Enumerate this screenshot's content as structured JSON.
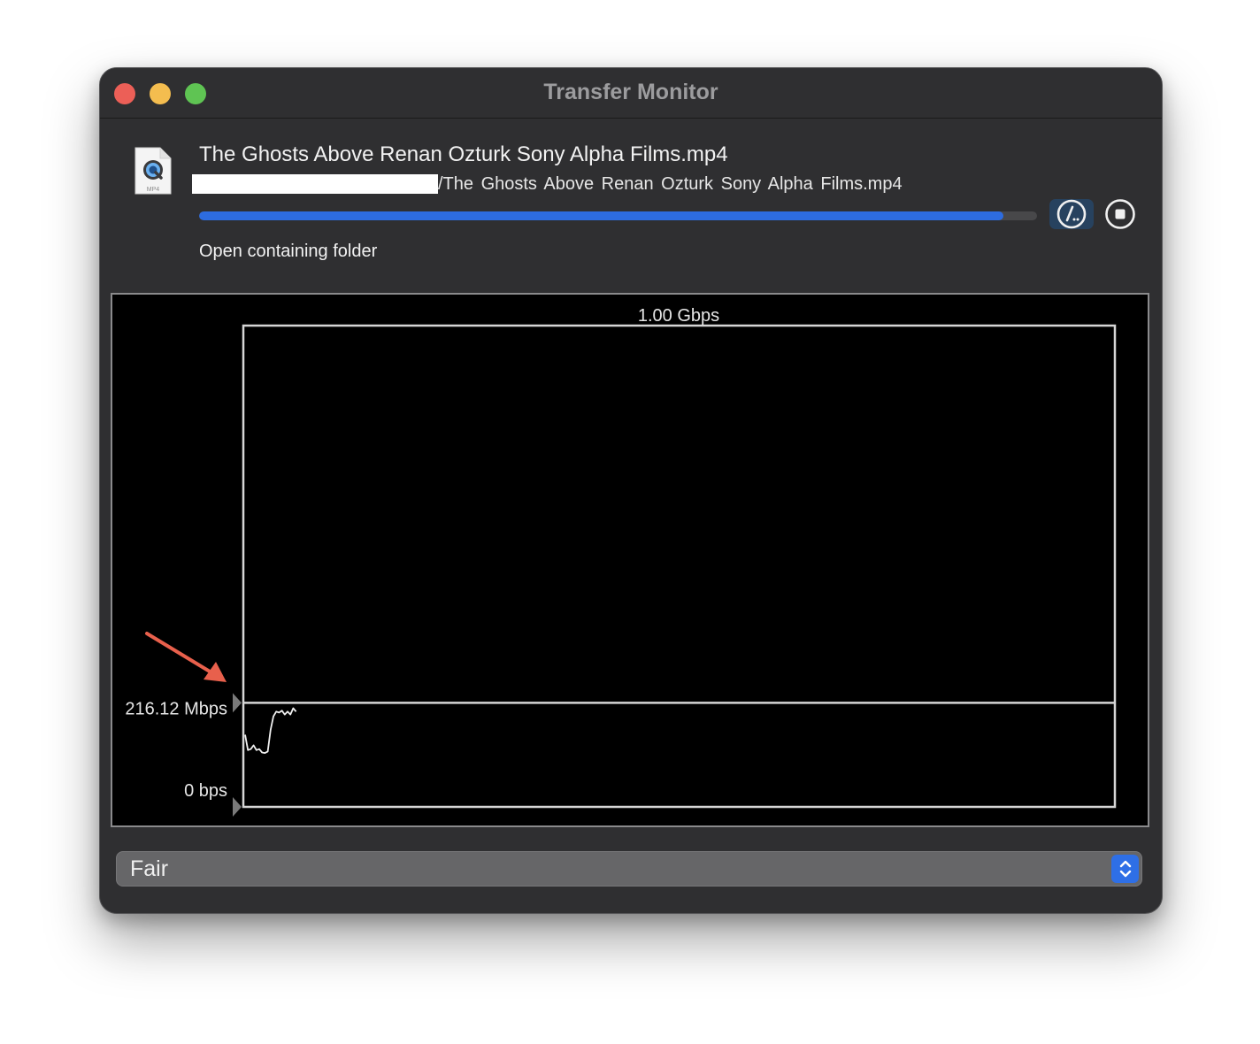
{
  "window": {
    "title": "Transfer Monitor"
  },
  "transfer": {
    "file_name": "The Ghosts Above Renan Ozturk Sony Alpha Films.mp4",
    "file_type": "MP4",
    "path_suffix": "/The Ghosts Above   Renan Ozturk   Sony Alpha Films.mp4",
    "progress_percent": 96,
    "open_folder_label": "Open containing folder"
  },
  "icons": {
    "file": "mp4-file-icon",
    "speed": "speedometer-icon",
    "stop": "stop-icon",
    "select": "chevron-up-down-icon"
  },
  "chart_data": {
    "type": "line",
    "title": "",
    "ymax_label": "1.00 Gbps",
    "current_label": "216.12 Mbps",
    "ymin_label": "0 bps",
    "current_value_mbps": 216.12,
    "ylim_mbps": [
      0,
      1000
    ],
    "series": [
      {
        "values": [
          150,
          118,
          120,
          128,
          118,
          120,
          113,
          112,
          115,
          160,
          188,
          198,
          196,
          200,
          192,
          198,
          192,
          205,
          198
        ]
      }
    ]
  },
  "quality": {
    "selected": "Fair"
  },
  "colors": {
    "accent": "#2d6ce0",
    "annotation_arrow": "#e8604c",
    "window_bg": "#2f2f31"
  }
}
